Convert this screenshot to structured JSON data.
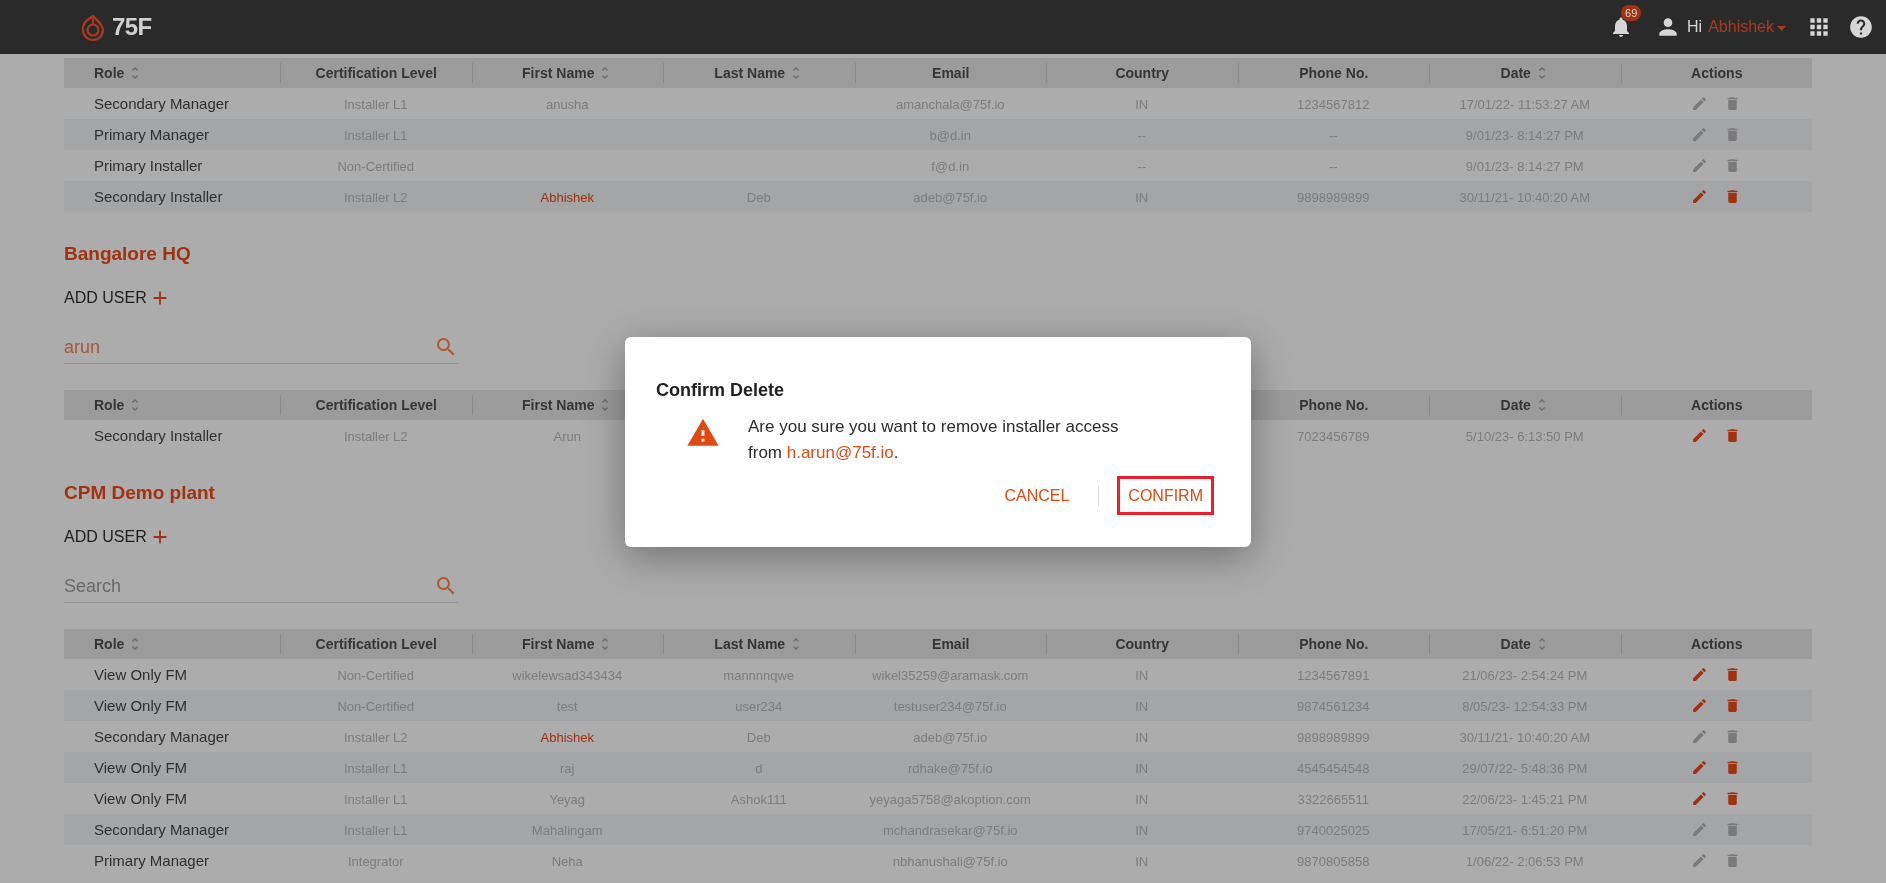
{
  "header": {
    "logo_text": "75F",
    "notification_count": "69",
    "greeting": "Hi",
    "user_name": "Abhishek"
  },
  "sections": [
    {
      "table": {
        "columns": [
          {
            "label": "Role",
            "sortable": true
          },
          {
            "label": "Certification Level",
            "sortable": false
          },
          {
            "label": "First Name",
            "sortable": true
          },
          {
            "label": "Last Name",
            "sortable": true
          },
          {
            "label": "Email",
            "sortable": false
          },
          {
            "label": "Country",
            "sortable": false
          },
          {
            "label": "Phone No.",
            "sortable": false
          },
          {
            "label": "Date",
            "sortable": true
          },
          {
            "label": "Actions",
            "sortable": false
          }
        ],
        "rows": [
          {
            "cells": [
              "Secondary Manager",
              "Installer L1",
              "anusha",
              null,
              "amanchala@75f.io",
              "IN",
              "1234567812",
              "17/01/22- 11:53:27 AM"
            ],
            "name_highlighted": false,
            "actions_enabled": false
          },
          {
            "cells": [
              "Primary Manager",
              "Installer L1",
              null,
              null,
              "b@d.in",
              "--",
              "--",
              "9/01/23- 8:14:27 PM"
            ],
            "actions_enabled": false
          },
          {
            "cells": [
              "Primary Installer",
              "Non-Certified",
              null,
              null,
              "f@d.in",
              "--",
              "--",
              "9/01/23- 8:14:27 PM"
            ],
            "actions_enabled": false
          },
          {
            "cells": [
              "Secondary Installer",
              "Installer L2",
              "Abhishek",
              "Deb",
              "adeb@75f.io",
              "IN",
              "9898989899",
              "30/11/21- 10:40:20 AM"
            ],
            "name_highlighted": true,
            "actions_enabled": true
          }
        ]
      }
    },
    {
      "title": "Bangalore HQ",
      "add_user_label": "ADD USER",
      "search": {
        "value": "arun"
      },
      "table": {
        "columns": [
          {
            "label": "Role",
            "sortable": true
          },
          {
            "label": "Certification Level",
            "sortable": false
          },
          {
            "label": "First Name",
            "sortable": true
          },
          {
            "label": "Phone No.",
            "sortable": false
          },
          {
            "label": "Date",
            "sortable": true
          },
          {
            "label": "Actions",
            "sortable": false
          }
        ],
        "rows": [
          {
            "cells": [
              "Secondary Installer",
              "Installer L2",
              "Arun",
              null,
              null,
              null,
              "7023456789",
              "5/10/23- 6:13:50 PM"
            ],
            "name_highlighted": false,
            "actions_enabled": true
          }
        ]
      }
    },
    {
      "title": "CPM Demo plant",
      "add_user_label": "ADD USER",
      "search": {
        "placeholder": "Search"
      },
      "table": {
        "columns": [
          {
            "label": "Role",
            "sortable": true
          },
          {
            "label": "Certification Level",
            "sortable": false
          },
          {
            "label": "First Name",
            "sortable": true
          },
          {
            "label": "Last Name",
            "sortable": true
          },
          {
            "label": "Email",
            "sortable": false
          },
          {
            "label": "Country",
            "sortable": false
          },
          {
            "label": "Phone No.",
            "sortable": false
          },
          {
            "label": "Date",
            "sortable": true
          },
          {
            "label": "Actions",
            "sortable": false
          }
        ],
        "rows": [
          {
            "cells": [
              "View Only FM",
              "Non-Certified",
              "wikelewsad343434",
              "mannnnqwe",
              "wikel35259@aramask.com",
              "IN",
              "1234567891",
              "21/06/23- 2:54:24 PM"
            ],
            "name_highlighted": false,
            "actions_enabled": true
          },
          {
            "cells": [
              "View Only FM",
              "Non-Certified",
              "test",
              "user234",
              "testuser234@75f.io",
              "IN",
              "9874561234",
              "8/05/23- 12:54:33 PM"
            ],
            "name_highlighted": false,
            "actions_enabled": true
          },
          {
            "cells": [
              "Secondary Manager",
              "Installer L2",
              "Abhishek",
              "Deb",
              "adeb@75f.io",
              "IN",
              "9898989899",
              "30/11/21- 10:40:20 AM"
            ],
            "name_highlighted": true,
            "actions_enabled": false
          },
          {
            "cells": [
              "View Only FM",
              "Installer L1",
              "raj",
              "d",
              "rdhake@75f.io",
              "IN",
              "4545454548",
              "29/07/22- 5:48:36 PM"
            ],
            "name_highlighted": false,
            "actions_enabled": true
          },
          {
            "cells": [
              "View Only FM",
              "Installer L1",
              "Yeyag",
              "Ashok111",
              "yeyaga5758@akoption.com",
              "IN",
              "3322665511",
              "22/06/23- 1:45:21 PM"
            ],
            "name_highlighted": false,
            "actions_enabled": true
          },
          {
            "cells": [
              "Secondary Manager",
              "Installer L1",
              "Mahalingam",
              null,
              "mchandrasekar@75f.io",
              "IN",
              "9740025025",
              "17/05/21- 6:51:20 PM"
            ],
            "name_highlighted": false,
            "actions_enabled": false
          },
          {
            "cells": [
              "Primary Manager",
              "Integrator",
              "Neha",
              null,
              "nbhanushali@75f.io",
              "IN",
              "9870805858",
              "1/06/22- 2:06:53 PM"
            ],
            "name_highlighted": false,
            "actions_enabled": false
          }
        ]
      }
    }
  ],
  "dialog": {
    "title": "Confirm Delete",
    "message": "Are you sure you want to remove installer access from",
    "email": "h.arun@75f.io",
    "message_end": ".",
    "buttons": [
      {
        "label": "CANCEL",
        "focused": false
      },
      {
        "label": "CONFIRM",
        "focused": true
      }
    ]
  }
}
